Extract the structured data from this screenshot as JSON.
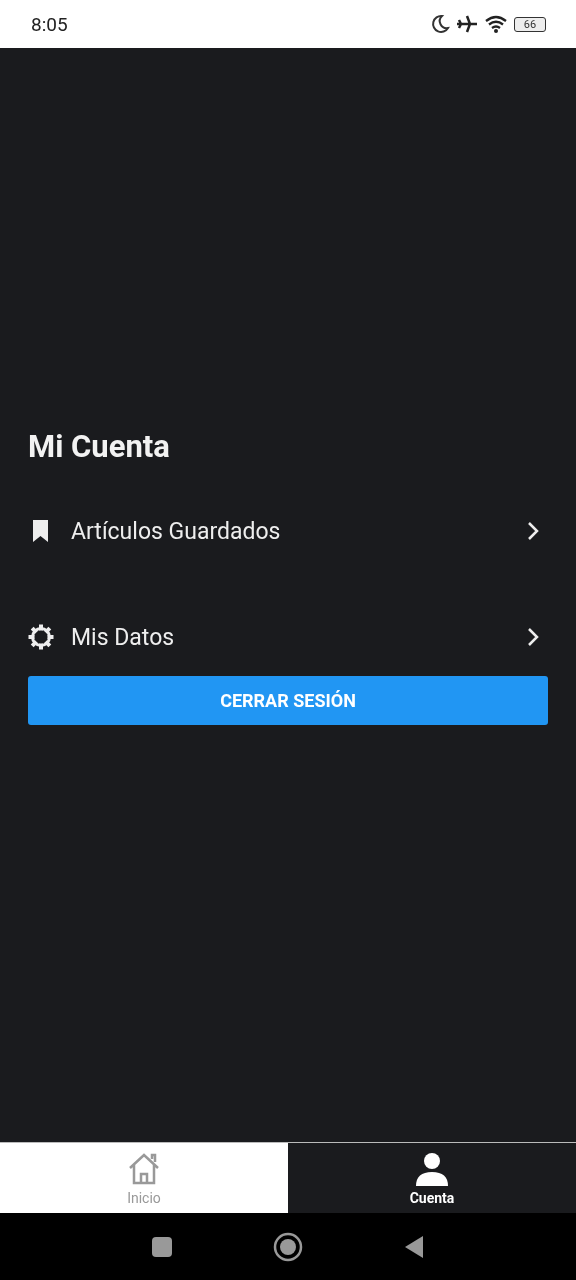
{
  "status_bar": {
    "time": "8:05",
    "battery": "66"
  },
  "title": "Mi Cuenta",
  "menu_items": [
    {
      "label": "Artículos Guardados",
      "kind": "bookmark"
    },
    {
      "label": "Mis Datos",
      "kind": "gear"
    }
  ],
  "logout_button": "CERRAR SESIÓN",
  "tabs": [
    {
      "label": "Inicio",
      "kind": "home",
      "selected": false
    },
    {
      "label": "Cuenta",
      "kind": "person",
      "selected": true
    }
  ]
}
